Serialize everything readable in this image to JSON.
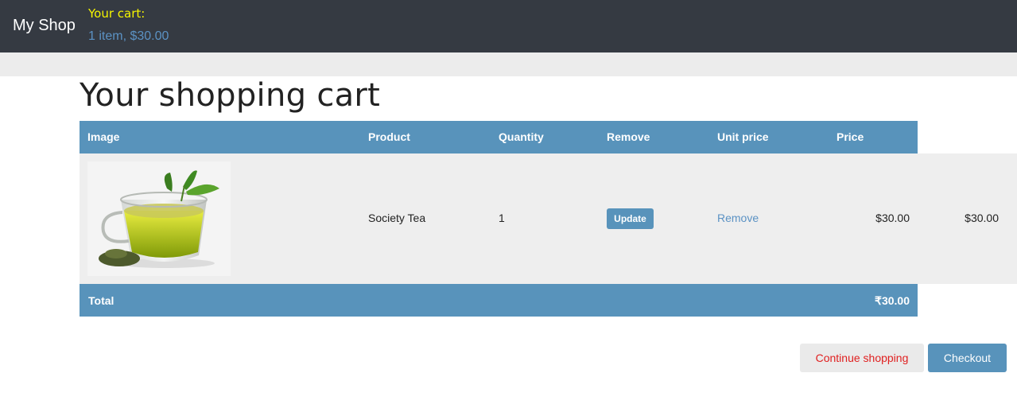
{
  "header": {
    "brand": "My Shop",
    "cart_title": "Your cart:",
    "cart_summary": "1 item, $30.00"
  },
  "page": {
    "title": "Your shopping cart"
  },
  "table": {
    "columns": [
      "Image",
      "Product",
      "Quantity",
      "Remove",
      "Unit price",
      "Price"
    ],
    "rows": [
      {
        "image": "green tea cup",
        "product": "Society Tea",
        "quantity": "1",
        "update_label": "Update",
        "remove_label": "Remove",
        "unit_price": "$30.00",
        "price": "$30.00"
      }
    ],
    "total_label": "Total",
    "total_value": "₹30.00"
  },
  "actions": {
    "continue_label": "Continue shopping",
    "checkout_label": "Checkout"
  },
  "colors": {
    "header_bg": "#353a42",
    "accent": "#5893bb",
    "cart_title": "#f5f500",
    "continue_text": "#e02020"
  }
}
